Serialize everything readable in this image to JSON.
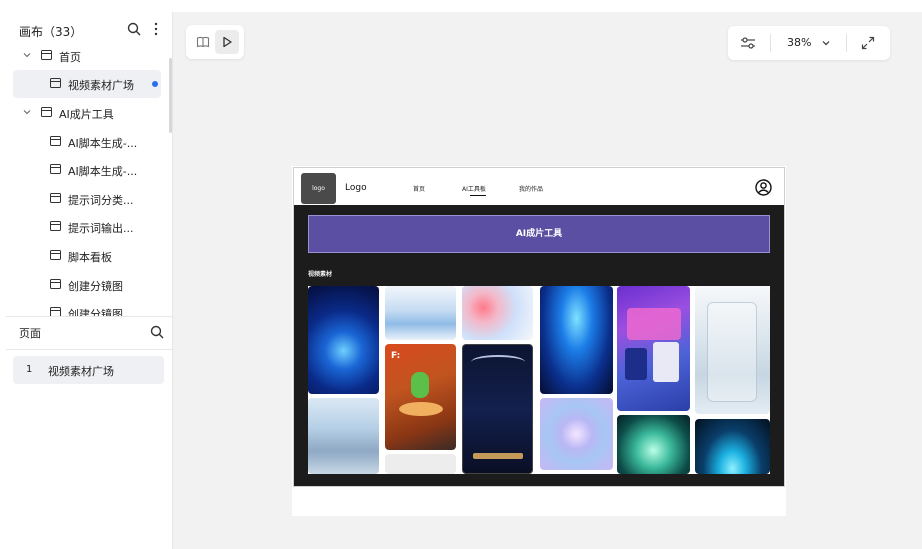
{
  "sidebar": {
    "title": "画布（33）",
    "tree": [
      {
        "label": "首页",
        "level": 0,
        "expanded": true
      },
      {
        "label": "视频素材广场",
        "level": 1,
        "active": true,
        "dot": true
      },
      {
        "label": "AI成片工具",
        "level": 0,
        "expanded": true
      },
      {
        "label": "AI脚本生成-...",
        "level": 1
      },
      {
        "label": "AI脚本生成-...",
        "level": 1
      },
      {
        "label": "提示词分类...",
        "level": 1
      },
      {
        "label": "提示词输出...",
        "level": 1
      },
      {
        "label": "脚本看板",
        "level": 1
      },
      {
        "label": "创建分镜图",
        "level": 1
      },
      {
        "label": "创建分镜图",
        "level": 1
      }
    ],
    "pages_title": "页面",
    "pages": [
      {
        "num": "1",
        "label": "视频素材广场"
      }
    ]
  },
  "canvas": {
    "zoom": "38%"
  },
  "preview": {
    "logo_box": "logo",
    "logo_text": "Logo",
    "nav": [
      "首页",
      "AI工具板",
      "我的作品"
    ],
    "active_nav": "AI工具板",
    "banner": "AI成片工具",
    "section_title": "视频素材",
    "tile_text": "F:"
  },
  "colors": {
    "accent_dot": "#2a6ff0",
    "banner_bg": "#5b4fa3",
    "preview_body_bg": "#1c1c1c",
    "canvas_bg": "#f2f2f2"
  }
}
